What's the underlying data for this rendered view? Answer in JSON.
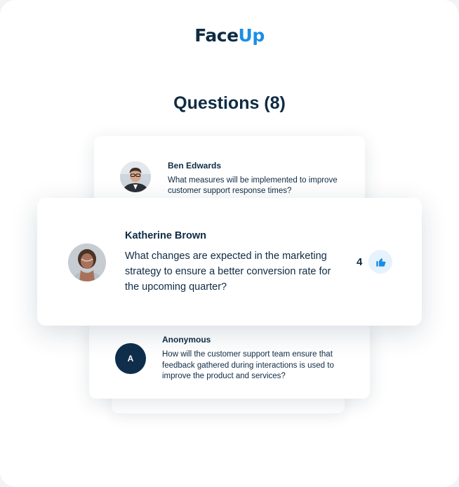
{
  "brand": {
    "name_prefix": "Face",
    "name_accent": "Up"
  },
  "page_title": "Questions (8)",
  "questions": [
    {
      "author": "Ben Edwards",
      "text": "What measures will be implemented to improve customer support response times?"
    },
    {
      "author": "Katherine Brown",
      "text": "What changes are expected in the marketing strategy to ensure a better conversion rate for the upcoming quarter?",
      "likes": "4"
    },
    {
      "author": "Anonymous",
      "initial": "A",
      "text": "How will the customer support team ensure that feedback gathered during interactions is used to improve the product and services?"
    }
  ],
  "colors": {
    "navy": "#0e2b44",
    "accent": "#1a8ee6",
    "like_bg": "#e6f2fd"
  },
  "icons": {
    "like": "thumbs-up-icon"
  }
}
